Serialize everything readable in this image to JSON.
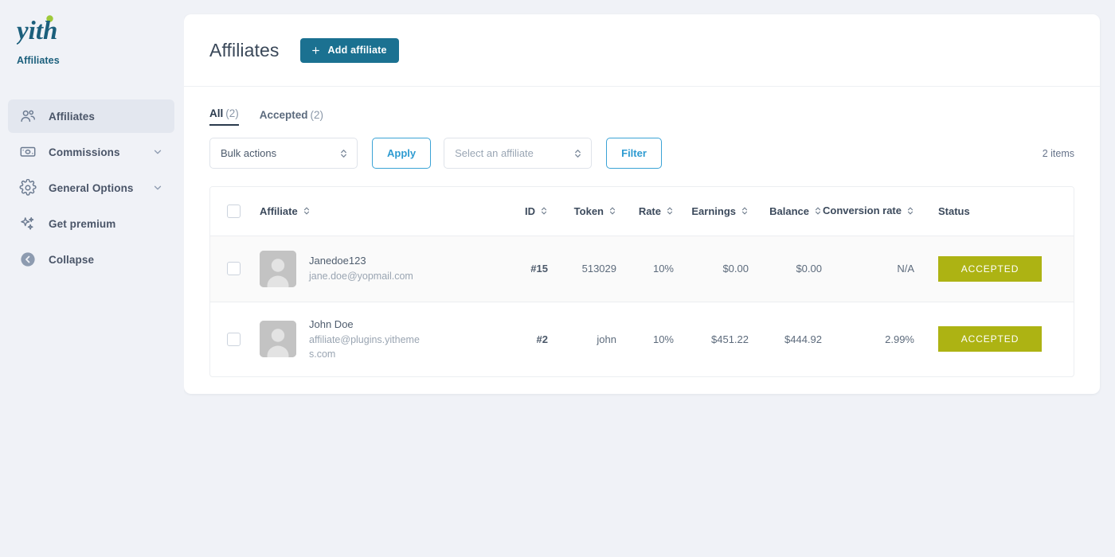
{
  "brand": {
    "logo_text": "yith",
    "subtitle": "Affiliates"
  },
  "sidebar": {
    "items": [
      {
        "label": "Affiliates",
        "icon": "people-icon",
        "active": true,
        "chevron": false
      },
      {
        "label": "Commissions",
        "icon": "banknote-icon",
        "active": false,
        "chevron": true
      },
      {
        "label": "General Options",
        "icon": "gear-icon",
        "active": false,
        "chevron": true
      },
      {
        "label": "Get premium",
        "icon": "sparkles-icon",
        "active": false,
        "chevron": false
      },
      {
        "label": "Collapse",
        "icon": "arrow-left-circle-icon",
        "active": false,
        "chevron": false
      }
    ]
  },
  "header": {
    "title": "Affiliates",
    "add_button": "Add affiliate",
    "add_icon": "plus-icon"
  },
  "tabs": [
    {
      "label": "All",
      "count": "(2)",
      "active": true
    },
    {
      "label": "Accepted",
      "count": "(2)",
      "active": false
    }
  ],
  "filters": {
    "bulk_actions_value": "Bulk actions",
    "apply_label": "Apply",
    "affiliate_select_placeholder": "Select an affiliate",
    "filter_label": "Filter",
    "items_count": "2 items"
  },
  "table": {
    "columns": [
      {
        "label": "Affiliate",
        "sortable": true
      },
      {
        "label": "ID",
        "sortable": true
      },
      {
        "label": "Token",
        "sortable": true
      },
      {
        "label": "Rate",
        "sortable": true
      },
      {
        "label": "Earnings",
        "sortable": true
      },
      {
        "label": "Balance",
        "sortable": true
      },
      {
        "label": "Conversion rate",
        "sortable": true
      },
      {
        "label": "Status",
        "sortable": false
      }
    ],
    "rows": [
      {
        "name": "Janedoe123",
        "email": "jane.doe@yopmail.com",
        "id": "#15",
        "token": "513029",
        "rate": "10%",
        "earnings": "$0.00",
        "balance": "$0.00",
        "conversion_rate": "N/A",
        "status": "ACCEPTED"
      },
      {
        "name": "John Doe",
        "email": "affiliate@plugins.yithemes.com",
        "id": "#2",
        "token": "john",
        "rate": "10%",
        "earnings": "$451.22",
        "balance": "$444.92",
        "conversion_rate": "2.99%",
        "status": "ACCEPTED"
      }
    ]
  },
  "colors": {
    "brand_teal": "#1b7191",
    "accent_blue": "#2e9bd1",
    "status_olive": "#adb313",
    "page_bg": "#f0f2f7"
  }
}
